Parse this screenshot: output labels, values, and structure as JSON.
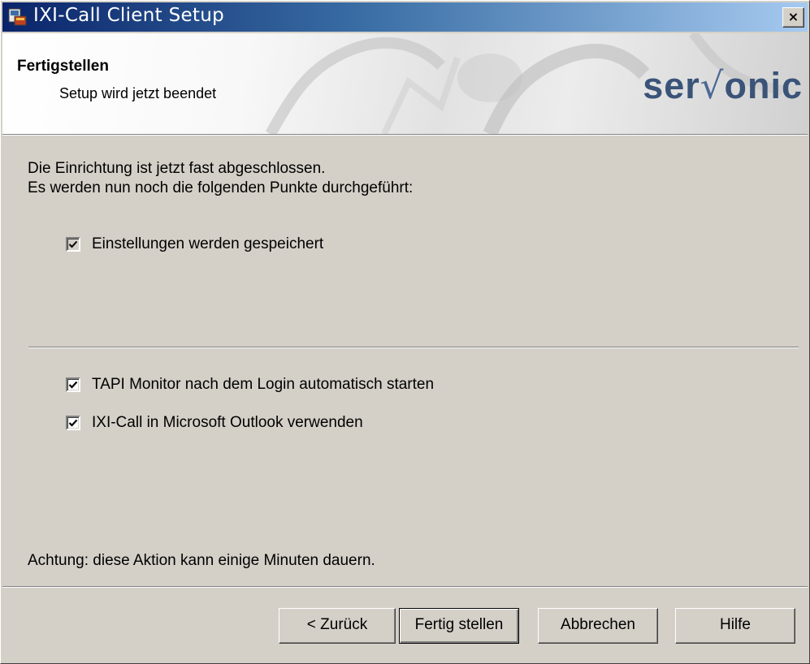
{
  "window": {
    "title": "IXI-Call Client Setup",
    "close_label": "×"
  },
  "banner": {
    "title": "Fertigstellen",
    "subtitle": "Setup wird jetzt beendet",
    "brand_left": "ser",
    "brand_v": "√",
    "brand_right": "onic"
  },
  "content": {
    "intro_line1": "Die Einrichtung ist jetzt fast abgeschlossen.",
    "intro_line2": "Es werden nun noch die folgenden Punkte durchgeführt:",
    "tasks": [
      {
        "label": "Einstellungen werden gespeichert",
        "checked": true,
        "enabled": false
      }
    ],
    "options": [
      {
        "label": "TAPI Monitor nach dem Login automatisch starten",
        "checked": true
      },
      {
        "label": "IXI-Call in Microsoft Outlook verwenden",
        "checked": true
      }
    ],
    "warning": "Achtung: diese Aktion kann einige Minuten dauern."
  },
  "buttons": {
    "back": "< Zurück",
    "finish": "Fertig stellen",
    "cancel": "Abbrechen",
    "help": "Hilfe"
  }
}
